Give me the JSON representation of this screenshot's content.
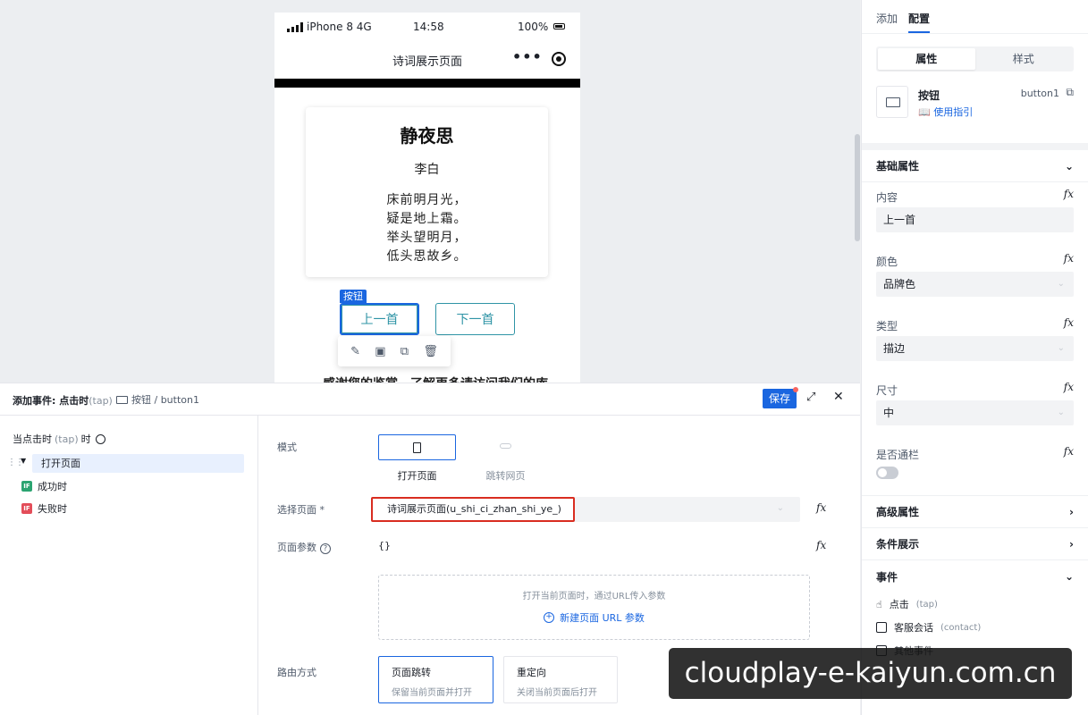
{
  "phone": {
    "carrier": "iPhone 8  4G",
    "time": "14:58",
    "battery": "100%",
    "nav_title": "诗词展示页面",
    "nav_more": "•••",
    "poem": {
      "title": "静夜思",
      "author": "李白",
      "lines": [
        "床前明月光，",
        "疑是地上霜。",
        "举头望明月，",
        "低头思故乡。"
      ]
    },
    "selected_tag": "按钮",
    "prev_button": "上一首",
    "next_button": "下一首",
    "toolbar_icons": [
      "edit-icon",
      "save-icon",
      "copy-icon",
      "delete-icon"
    ],
    "cut_text": "感谢您的鉴赏，了解更多请访问我们的库"
  },
  "right_panel": {
    "tabs": [
      "添加",
      "配置"
    ],
    "active_tab": "配置",
    "segments": [
      "属性",
      "样式"
    ],
    "component": {
      "name": "按钮",
      "id": "button1",
      "guide": "使用指引"
    },
    "basic_section": "基础属性",
    "fields": [
      {
        "label": "内容",
        "value": "上一首",
        "fx": "fx"
      },
      {
        "label": "颜色",
        "value": "品牌色",
        "fx": "fx"
      },
      {
        "label": "类型",
        "value": "描边",
        "fx": "fx"
      },
      {
        "label": "尺寸",
        "value": "中",
        "fx": "fx"
      }
    ],
    "full_width": {
      "label": "是否通栏",
      "fx": "fx"
    },
    "advanced_section": "高级属性",
    "condition_section": "条件展示",
    "events_section": "事件",
    "events": [
      {
        "label": "点击",
        "sub": "(tap)"
      },
      {
        "label": "客服会话",
        "sub": "(contact)"
      },
      {
        "label": "其他事件",
        "sub": ""
      }
    ]
  },
  "bottom_panel": {
    "title": "添加事件: 点击时",
    "title_tap": "(tap)",
    "component_path": "按钮 / button1",
    "save": "保存",
    "trigger": "当点击时",
    "trigger_tap": "(tap)",
    "trigger_suffix": "时",
    "action": "打开页面",
    "on_success": "成功时",
    "on_fail": "失败时",
    "mode_label": "模式",
    "mode_open": "打开页面",
    "mode_link": "跳转网页",
    "select_page_label": "选择页面 *",
    "select_page_value": "诗词展示页面(u_shi_ci_zhan_shi_ye_)",
    "page_params_label": "页面参数",
    "page_params_value": "{}",
    "params_hint": "打开当前页面时，通过URL传入参数",
    "params_add": "新建页面 URL 参数",
    "route_label": "路由方式",
    "route_navigate_title": "页面跳转",
    "route_navigate_desc": "保留当前页面并打开",
    "route_redirect_title": "重定向",
    "route_redirect_desc": "关闭当前页面后打开",
    "fx": "fx"
  },
  "watermark": "cloudplay-e-kaiyun.com.cn",
  "colors": {
    "brand": "#1a66e0",
    "button_outline": "#2f94a6",
    "highlight_red": "#d92d20",
    "success_green": "#2ba471",
    "fail_red": "#e34d59"
  }
}
